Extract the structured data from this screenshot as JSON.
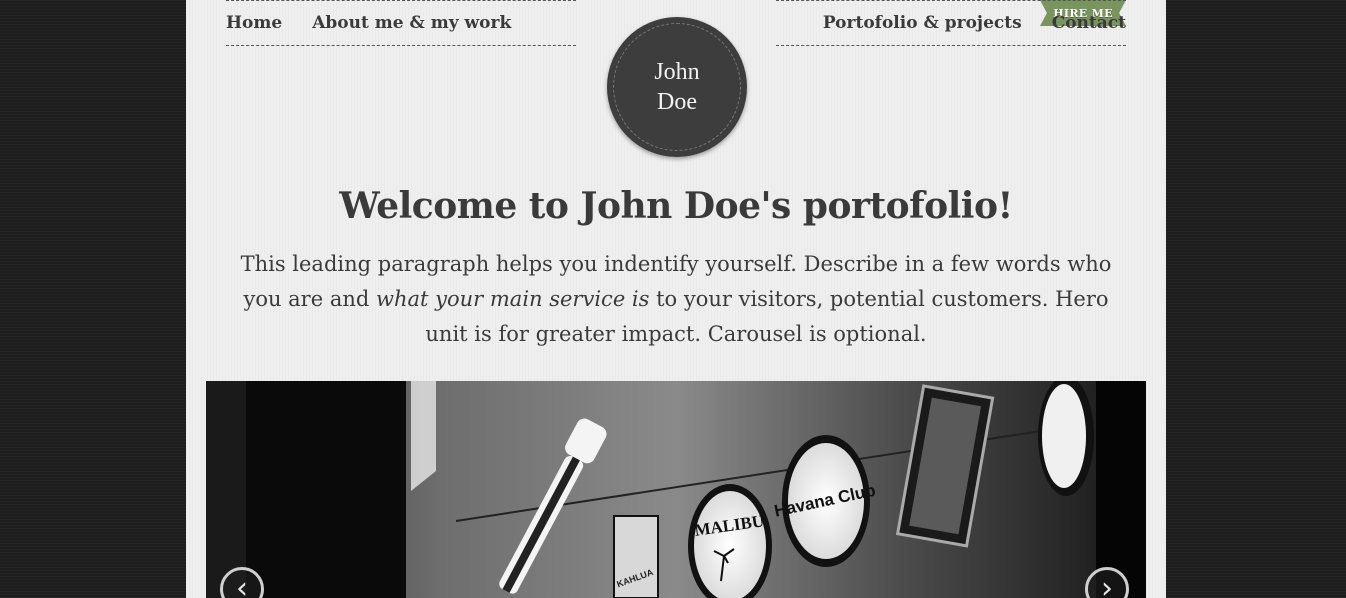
{
  "ribbon": {
    "label": "HIRE ME"
  },
  "nav": {
    "left": [
      {
        "label": "Home"
      },
      {
        "label": "About me & my work"
      }
    ],
    "right": [
      {
        "label": "Portofolio & projects"
      },
      {
        "label": "Contact"
      }
    ]
  },
  "logo": {
    "line1": "John",
    "line2": "Doe"
  },
  "hero": {
    "title": "Welcome to John Doe's portofolio!",
    "lead_part1": "This leading paragraph helps you indentify yourself. Describe in a few words who you are and ",
    "lead_emphasis": "what your main service is",
    "lead_part2": " to your visitors, potential customers. Hero unit is for greater impact. Carousel is optional."
  },
  "carousel": {
    "signs": [
      "KAHLUA",
      "MALIBU",
      "Havana Club"
    ],
    "prev_icon": "chevron-left-icon",
    "next_icon": "chevron-right-icon"
  },
  "colors": {
    "page_background": "#1e1e1e",
    "content_background": "#efefef",
    "ribbon": "#7a9460",
    "logo_circle": "#3d3d3d",
    "text": "#3a3a3a"
  }
}
